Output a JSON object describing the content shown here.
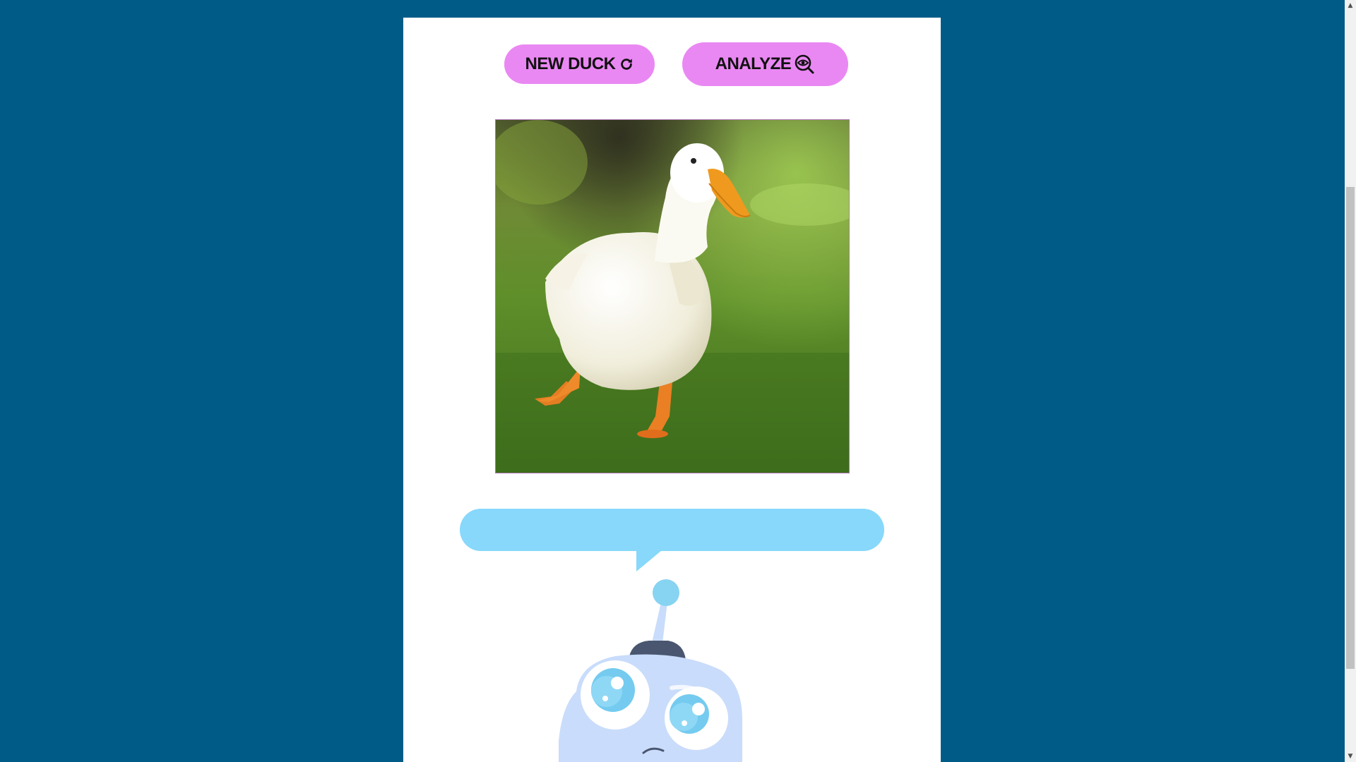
{
  "toolbar": {
    "new_duck_label": "NEW DUCK",
    "new_duck_icon": "refresh-icon",
    "analyze_label": "ANALYZE",
    "analyze_icon": "search-eye-icon"
  },
  "image": {
    "subject": "white duck walking on grass"
  },
  "speech_bubble": {
    "text": ""
  },
  "colors": {
    "page_background": "#005c87",
    "panel_background": "#ffffff",
    "button": "#ea88f3",
    "bubble": "#87d8fb",
    "robot_body": "#c9dcfb"
  },
  "scrollbar": {
    "up_icon": "triangle-up-icon",
    "down_icon": "triangle-down-icon"
  }
}
